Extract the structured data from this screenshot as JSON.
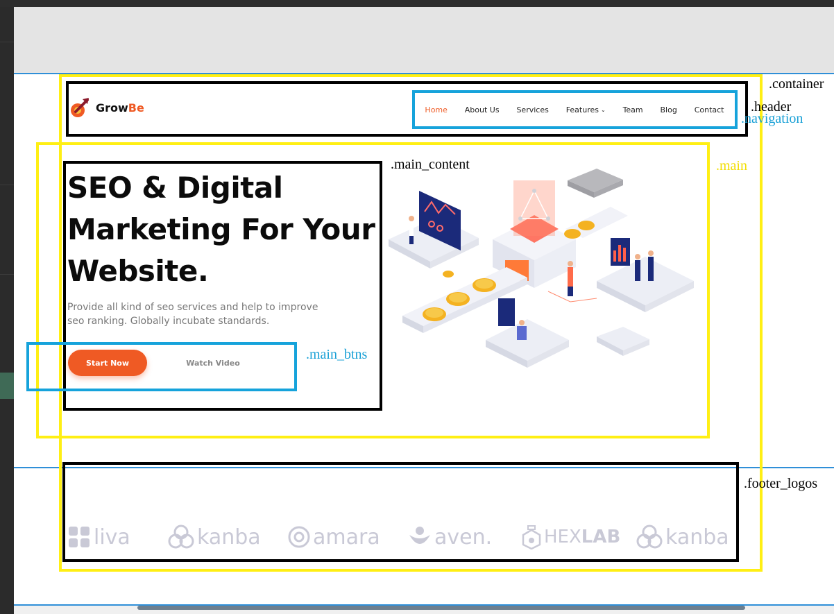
{
  "brand": {
    "name_prefix": "Grow",
    "name_accent": "Be",
    "accent_color": "#ef5a24"
  },
  "navigation": {
    "items": [
      {
        "label": "Home",
        "active": true
      },
      {
        "label": "About Us"
      },
      {
        "label": "Services"
      },
      {
        "label": "Features",
        "dropdown": true
      },
      {
        "label": "Team"
      },
      {
        "label": "Blog"
      },
      {
        "label": "Contact"
      }
    ]
  },
  "hero": {
    "title_line1": "SEO & Digital",
    "title_line2": "Marketing For Your",
    "title_line3": "Website.",
    "desc_line1": "Provide all kind of seo services and help to improve",
    "desc_line2": "seo ranking. Globally incubate standards.",
    "primary_button": "Start Now",
    "secondary_button": "Watch Video"
  },
  "footer_logos": [
    {
      "name": "liva",
      "icon": "leaf-squares-icon"
    },
    {
      "name": "kanba",
      "icon": "rings-icon"
    },
    {
      "name": "amara",
      "icon": "at-icon"
    },
    {
      "name": "aven.",
      "icon": "person-bowl-icon"
    },
    {
      "name_part1": "HEX",
      "name_part2": "LAB",
      "icon": "flask-icon"
    },
    {
      "name": "kanba",
      "icon": "rings-icon"
    }
  ],
  "debug_labels": {
    "container": ".container",
    "header": ".header",
    "navigation": ".navigation",
    "main": ".main",
    "main_content": ".main_content",
    "main_btns": ".main_btns",
    "footer_logos": ".footer_logos"
  },
  "colors": {
    "outline_yellow": "#ffef14",
    "outline_black": "#000000",
    "outline_blue": "#16a3db",
    "guide_blue": "#2f8fd8"
  }
}
